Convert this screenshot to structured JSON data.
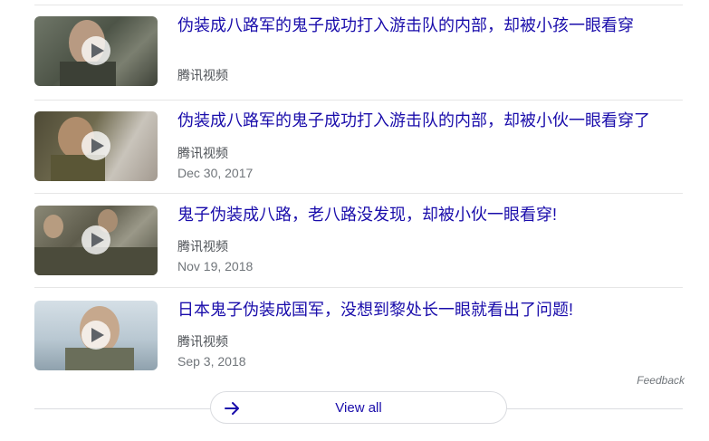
{
  "results": [
    {
      "title": "伪装成八路军的鬼子成功打入游击队的内部，却被小孩一眼看穿",
      "source": "腾讯视频",
      "date": ""
    },
    {
      "title": "伪装成八路军的鬼子成功打入游击队的内部，却被小伙一眼看穿了",
      "source": "腾讯视频",
      "date": "Dec 30, 2017"
    },
    {
      "title": "鬼子伪装成八路，老八路没发现，却被小伙一眼看穿!",
      "source": "腾讯视频",
      "date": "Nov 19, 2018"
    },
    {
      "title": "日本鬼子伪装成国军，没想到黎处长一眼就看出了问题!",
      "source": "腾讯视频",
      "date": "Sep 3, 2018"
    }
  ],
  "feedback_label": "Feedback",
  "view_all_label": "View all",
  "colors": {
    "link": "#1a0dab",
    "meta": "#70757a",
    "accent": "#1a0dab"
  }
}
